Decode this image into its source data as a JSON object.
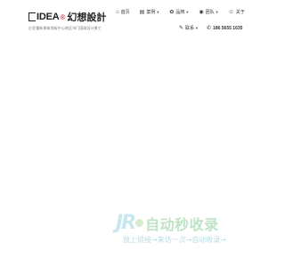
{
  "brand": {
    "logo_text": "IDEA",
    "logo_accent": "®",
    "logo_cn": "幻想設計",
    "tagline": "亿亚重新建筑地板中心地区市门国政设计景工"
  },
  "nav": {
    "items": [
      {
        "icon": "home-icon",
        "glyph": "⌂",
        "label": "首页",
        "has_caret": false
      },
      {
        "icon": "book-icon",
        "glyph": "▤",
        "label": "案例",
        "has_caret": true
      },
      {
        "icon": "gift-icon",
        "glyph": "✿",
        "label": "品牌",
        "has_caret": true
      },
      {
        "icon": "eye-icon",
        "glyph": "◉",
        "label": "团队",
        "has_caret": true
      },
      {
        "icon": "user-icon",
        "glyph": "☺",
        "label": "关于",
        "has_caret": false
      }
    ]
  },
  "contact": {
    "link_label": "联系",
    "link_glyph": "✎",
    "phone_glyph": "✆",
    "phone": "186 5655 1635"
  },
  "watermark": {
    "logo": "JR",
    "title": "自动秒收录",
    "subtitle": "放上链接→来访一次→自动收录→"
  },
  "colors": {
    "accent_red": "#c8161d",
    "watermark_blue": "#c8e7ef",
    "watermark_green": "#bfe3c6"
  }
}
